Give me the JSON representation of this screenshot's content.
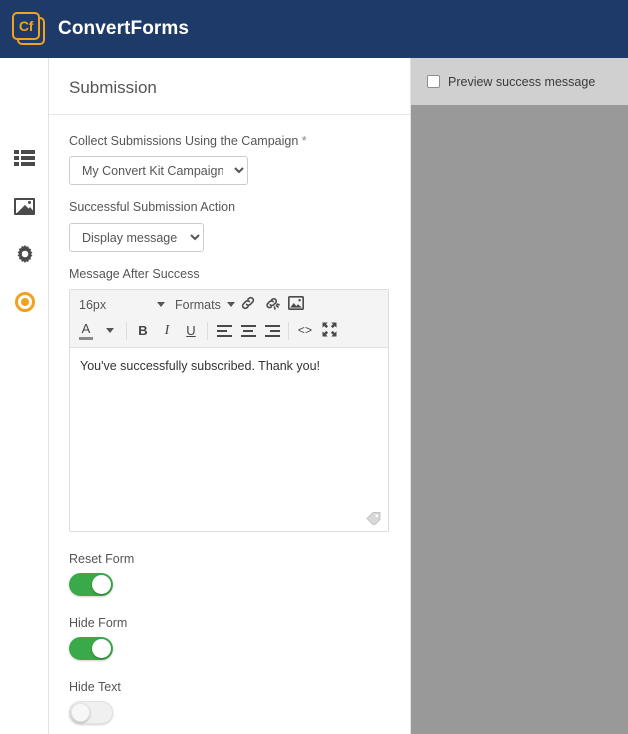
{
  "header": {
    "brand_mark": "Cf",
    "brand_name": "ConvertForms",
    "bg_color": "#1e3a68",
    "accent_color": "#f0a11e"
  },
  "sidebar": {
    "items": [
      {
        "icon": "list-icon",
        "name": "forms"
      },
      {
        "icon": "image-icon",
        "name": "media"
      },
      {
        "icon": "gear-icon",
        "name": "settings"
      },
      {
        "icon": "target-icon",
        "name": "campaigns",
        "active": true
      }
    ]
  },
  "panel": {
    "title": "Submission",
    "fields": {
      "campaign": {
        "label": "Collect Submissions Using the Campaign",
        "required_mark": "*",
        "value": "My Convert Kit Campaign",
        "options": [
          "My Convert Kit Campaign"
        ]
      },
      "action": {
        "label": "Successful Submission Action",
        "value": "Display message",
        "options": [
          "Display message"
        ]
      },
      "message": {
        "label": "Message After Success",
        "content": "You've successfully subscribed. Thank you!"
      }
    },
    "editor_toolbar": {
      "font_size": "16px",
      "formats": "Formats",
      "buttons": [
        "link-icon",
        "unlink-icon",
        "image-icon",
        "text-color-icon",
        "bold-icon",
        "italic-icon",
        "underline-icon",
        "align-left-icon",
        "align-center-icon",
        "align-right-icon",
        "source-code-icon",
        "fullscreen-icon"
      ],
      "bold_glyph": "B",
      "italic_glyph": "I",
      "underline_glyph": "U",
      "color_glyph": "A",
      "code_glyph": "<>"
    },
    "toggles": [
      {
        "label": "Reset Form",
        "state": "on"
      },
      {
        "label": "Hide Form",
        "state": "on"
      },
      {
        "label": "Hide Text",
        "state": "off"
      }
    ],
    "toggle_on_color": "#3aa949"
  },
  "preview": {
    "checkbox_label": "Preview success message",
    "checked": false,
    "bar_color": "#d0d0d0",
    "canvas_color": "#999999"
  }
}
